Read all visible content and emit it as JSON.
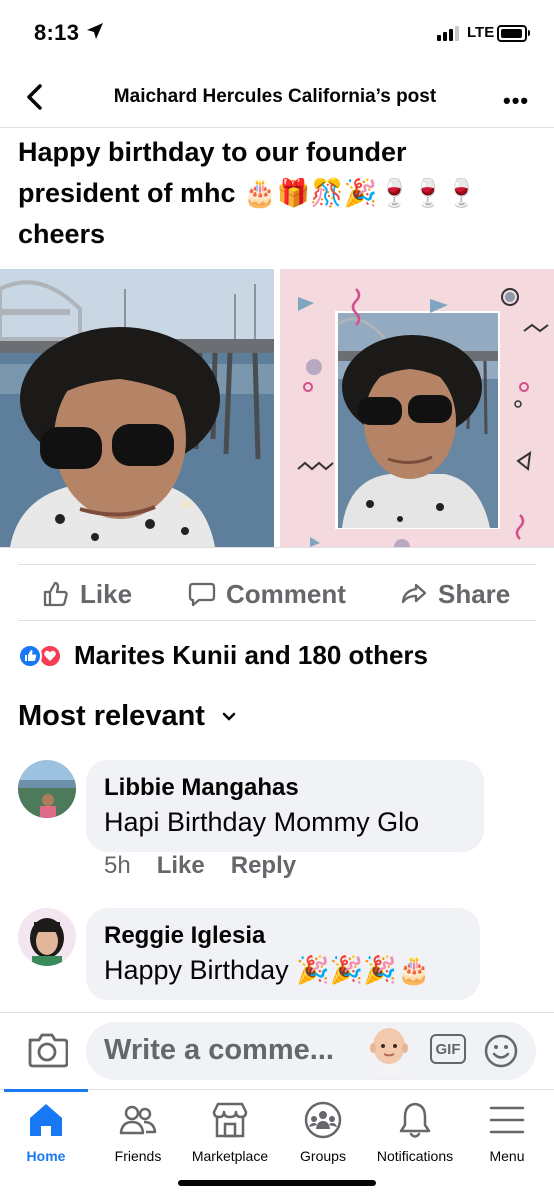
{
  "status_bar": {
    "time": "8:13",
    "network": "LTE"
  },
  "header": {
    "title": "Maichard Hercules California’s post",
    "more": "•••"
  },
  "post": {
    "text_line1": "Happy birthday to our founder",
    "text_line2": "president of mhc 🎂🎁🎊🎉🍷🍷🍷",
    "text_line3": "cheers"
  },
  "actions": {
    "like": "Like",
    "comment": "Comment",
    "share": "Share"
  },
  "reactions": {
    "summary": "Marites Kunii and 180 others"
  },
  "sort": {
    "label": "Most relevant"
  },
  "comments": [
    {
      "name": "Libbie Mangahas",
      "text": "Hapi Birthday Mommy Glo",
      "time": "5h",
      "like": "Like",
      "reply": "Reply"
    },
    {
      "name": "Reggie Iglesia",
      "text": "Happy Birthday 🎉🎉🎉🎂"
    }
  ],
  "composer": {
    "placeholder": "Write a comme...",
    "gif": "GIF"
  },
  "tabs": [
    {
      "label": "Home",
      "icon": "home-icon",
      "active": true
    },
    {
      "label": "Friends",
      "icon": "friends-icon"
    },
    {
      "label": "Marketplace",
      "icon": "marketplace-icon"
    },
    {
      "label": "Groups",
      "icon": "groups-icon"
    },
    {
      "label": "Notifications",
      "icon": "bell-icon"
    },
    {
      "label": "Menu",
      "icon": "menu-icon"
    }
  ],
  "colors": {
    "accent": "#1877f2",
    "love": "#f33e58",
    "secondary_text": "#65676b",
    "bubble": "#f0f2f5"
  }
}
